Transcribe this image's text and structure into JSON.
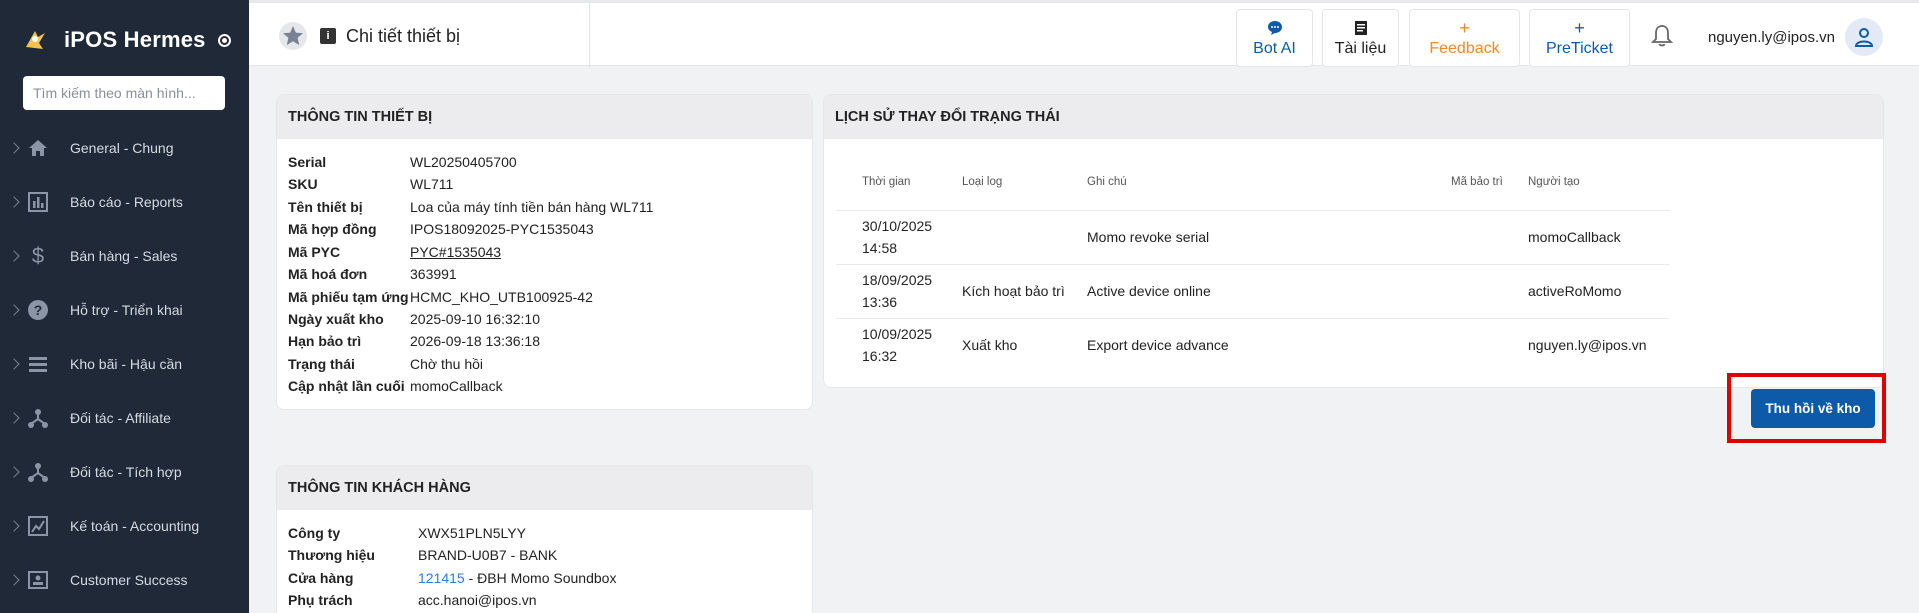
{
  "app": {
    "brand": "iPOS Hermes"
  },
  "sidebar": {
    "search_placeholder": "Tìm kiếm theo màn hình...",
    "items": [
      {
        "label": "General - Chung",
        "icon": "home-icon"
      },
      {
        "label": "Báo cáo - Reports",
        "icon": "bar-chart-icon"
      },
      {
        "label": "Bán hàng - Sales",
        "icon": "dollar-icon"
      },
      {
        "label": "Hỗ trợ - Triển khai",
        "icon": "help-circle-icon"
      },
      {
        "label": "Kho bãi - Hậu cần",
        "icon": "list-icon"
      },
      {
        "label": "Đối tác - Affiliate",
        "icon": "network-icon"
      },
      {
        "label": "Đối tác - Tích hợp",
        "icon": "network-icon"
      },
      {
        "label": "Kế toán - Accounting",
        "icon": "edit-chart-icon"
      },
      {
        "label": "Customer Success",
        "icon": "id-card-icon"
      }
    ]
  },
  "header": {
    "page_title": "Chi tiết thiết bị",
    "buttons": {
      "bot_ai": "Bot AI",
      "docs": "Tài liệu",
      "feedback": "Feedback",
      "preticket": "PreTicket"
    },
    "user_email": "nguyen.ly@ipos.vn",
    "colors": {
      "primary": "#0c5aa8",
      "feedback": "#f08a24",
      "link": "#2a7be4"
    }
  },
  "device_info": {
    "title": "THÔNG TIN THIẾT BỊ",
    "fields": [
      {
        "label": "Serial",
        "value": "WL20250405700"
      },
      {
        "label": "SKU",
        "value": "WL711"
      },
      {
        "label": "Tên thiết bị",
        "value": "Loa của máy tính tiền bán hàng WL711"
      },
      {
        "label": "Mã hợp đồng",
        "value": "IPOS18092025-PYC1535043"
      },
      {
        "label": "Mã PYC",
        "value": "PYC#1535043"
      },
      {
        "label": "Mã hoá đơn",
        "value": "363991"
      },
      {
        "label": "Mã phiếu tạm ứng",
        "value": "HCMC_KHO_UTB100925-42"
      },
      {
        "label": "Ngày xuất kho",
        "value": "2025-09-10 16:32:10"
      },
      {
        "label": "Hạn bảo trì",
        "value": "2026-09-18 13:36:18"
      },
      {
        "label": "Trạng thái",
        "value": "Chờ thu hồi"
      },
      {
        "label": "Cập nhật lần cuối",
        "value": "momoCallback"
      }
    ]
  },
  "customer_info": {
    "title": "THÔNG TIN KHÁCH HÀNG",
    "company_label": "Công ty",
    "company_value": "XWX51PLN5LYY",
    "brand_label": "Thương hiệu",
    "brand_value": "BRAND-U0B7 - BANK",
    "store_label": "Cửa hàng",
    "store_id": "121415",
    "store_name": " - ĐBH Momo Soundbox",
    "owner_label": "Phụ trách",
    "owner_value": "acc.hanoi@ipos.vn"
  },
  "history": {
    "title": "LỊCH SỬ THAY ĐỔI TRẠNG THÁI",
    "columns": [
      "Thời gian",
      "Loại log",
      "Ghi chú",
      "Mã bảo trì",
      "Người tạo"
    ],
    "rows": [
      {
        "date": "30/10/2025",
        "time": "14:58",
        "type": "",
        "note": "Momo revoke serial",
        "maint": "",
        "creator": "momoCallback"
      },
      {
        "date": "18/09/2025",
        "time": "13:36",
        "type": "Kích hoạt bảo trì",
        "note": "Active device online",
        "maint": "",
        "creator": "activeRoMomo"
      },
      {
        "date": "10/09/2025",
        "time": "16:32",
        "type": "Xuất kho",
        "note": "Export device advance",
        "maint": "",
        "creator": "nguyen.ly@ipos.vn"
      }
    ]
  },
  "actions": {
    "recall": "Thu hồi về kho"
  }
}
